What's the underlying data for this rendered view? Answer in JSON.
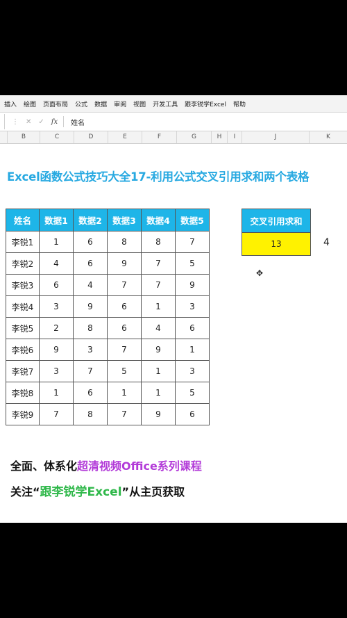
{
  "ribbon": {
    "tabs": [
      "插入",
      "绘图",
      "页面布局",
      "公式",
      "数据",
      "审阅",
      "视图",
      "开发工具",
      "跟李锐学Excel",
      "帮助"
    ]
  },
  "formula_bar": {
    "content": "姓名",
    "fx_label": "fx"
  },
  "columns": [
    "B",
    "C",
    "D",
    "E",
    "F",
    "G",
    "H",
    "I",
    "J",
    "K"
  ],
  "title": "Excel函数公式技巧大全17-利用公式交叉引用求和两个表格",
  "table": {
    "headers": [
      "姓名",
      "数据1",
      "数据2",
      "数据3",
      "数据4",
      "数据5"
    ],
    "rows": [
      [
        "李锐1",
        "1",
        "6",
        "8",
        "8",
        "7"
      ],
      [
        "李锐2",
        "4",
        "6",
        "9",
        "7",
        "5"
      ],
      [
        "李锐3",
        "6",
        "4",
        "7",
        "7",
        "9"
      ],
      [
        "李锐4",
        "3",
        "9",
        "6",
        "1",
        "3"
      ],
      [
        "李锐5",
        "2",
        "8",
        "6",
        "4",
        "6"
      ],
      [
        "李锐6",
        "9",
        "3",
        "7",
        "9",
        "1"
      ],
      [
        "李锐7",
        "3",
        "7",
        "5",
        "1",
        "3"
      ],
      [
        "李锐8",
        "1",
        "6",
        "1",
        "1",
        "5"
      ],
      [
        "李锐9",
        "7",
        "8",
        "7",
        "9",
        "6"
      ]
    ]
  },
  "sum_box": {
    "header": "交叉引用求和",
    "value": "13"
  },
  "stray_value": "4",
  "promo": {
    "line1_prefix": "全面、体系化",
    "line1_highlight": "超清视频Office系列课程",
    "line2_prefix": "关注“",
    "line2_highlight": "跟李锐学Excel",
    "line2_suffix": "”从主页获取"
  },
  "colors": {
    "header_bg": "#1eb5e8",
    "sum_bg": "#fff200",
    "title": "#27a9e1",
    "promo_purple": "#b23ad8",
    "promo_green": "#2fb84a"
  }
}
